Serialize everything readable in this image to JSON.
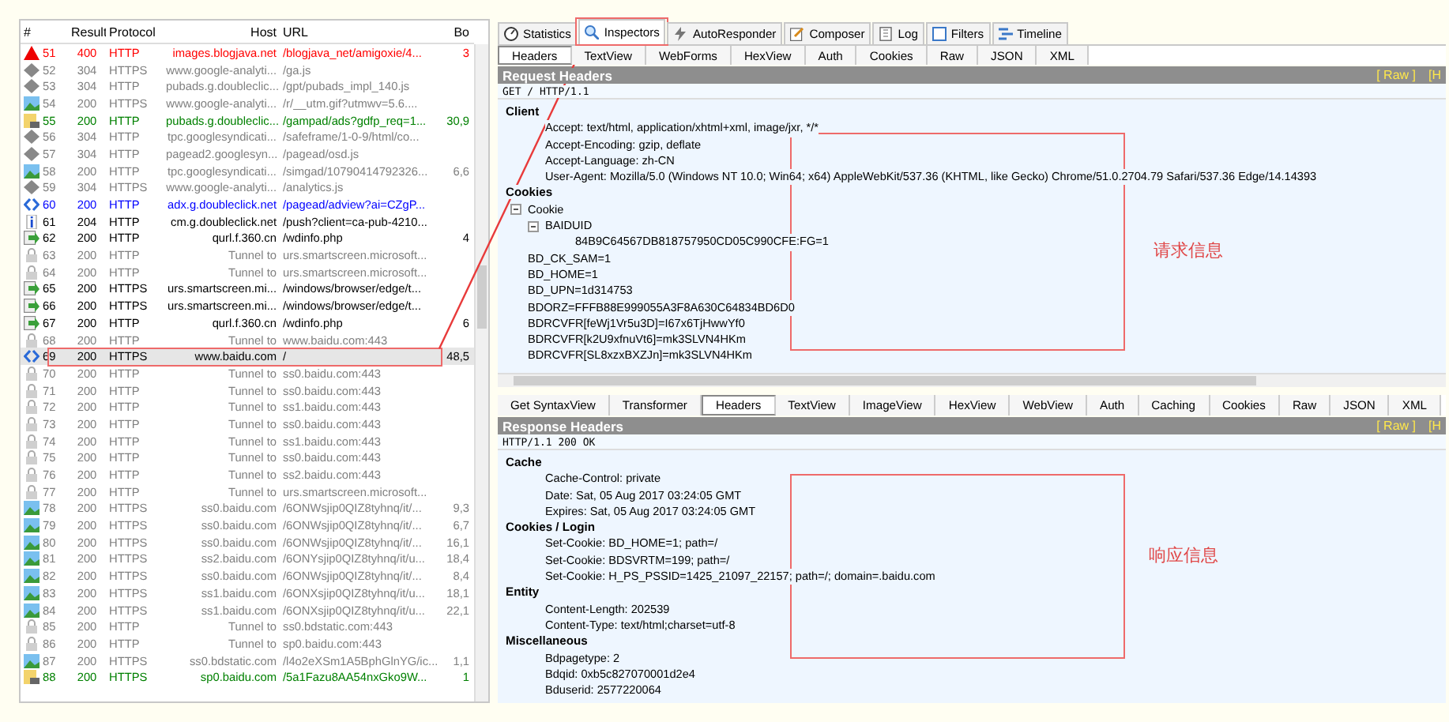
{
  "sessions": {
    "columns": [
      "#",
      "Result",
      "Protocol",
      "Host",
      "URL",
      "Bo"
    ],
    "rows": [
      {
        "num": "51",
        "result": "400",
        "protocol": "HTTP",
        "host": "images.blogjava.net",
        "url": "/blogjava_net/amigoxie/4...",
        "body": "3",
        "kind": "warning",
        "color": "#ff0000",
        "selected": false
      },
      {
        "num": "52",
        "result": "304",
        "protocol": "HTTPS",
        "host": "www.google-analyti...",
        "url": "/ga.js",
        "kind": "cached",
        "color": "#808080",
        "selected": false
      },
      {
        "num": "53",
        "result": "304",
        "protocol": "HTTP",
        "host": "pubads.g.doubleclic...",
        "url": "/gpt/pubads_impl_140.js",
        "kind": "cached",
        "color": "#808080",
        "selected": false
      },
      {
        "num": "54",
        "result": "200",
        "protocol": "HTTPS",
        "host": "www.google-analyti...",
        "url": "/r/__utm.gif?utmwv=5.6....",
        "kind": "image",
        "color": "#808080",
        "selected": false
      },
      {
        "num": "55",
        "result": "200",
        "protocol": "HTTP",
        "host": "pubads.g.doubleclic...",
        "url": "/gampad/ads?gdfp_req=1...",
        "body": "30,9",
        "kind": "script",
        "color": "#008000",
        "selected": false
      },
      {
        "num": "56",
        "result": "304",
        "protocol": "HTTP",
        "host": "tpc.googlesyndicati...",
        "url": "/safeframe/1-0-9/html/co...",
        "kind": "cached",
        "color": "#808080",
        "selected": false
      },
      {
        "num": "57",
        "result": "304",
        "protocol": "HTTP",
        "host": "pagead2.googlesyn...",
        "url": "/pagead/osd.js",
        "kind": "cached",
        "color": "#808080",
        "selected": false
      },
      {
        "num": "58",
        "result": "200",
        "protocol": "HTTP",
        "host": "tpc.googlesyndicati...",
        "url": "/simgad/10790414792326...",
        "body": "6,6",
        "kind": "image",
        "color": "#808080",
        "selected": false
      },
      {
        "num": "59",
        "result": "304",
        "protocol": "HTTPS",
        "host": "www.google-analyti...",
        "url": "/analytics.js",
        "kind": "cached",
        "color": "#808080",
        "selected": false
      },
      {
        "num": "60",
        "result": "200",
        "protocol": "HTTP",
        "host": "adx.g.doubleclick.net",
        "url": "/pagead/adview?ai=CZgP...",
        "kind": "page",
        "color": "#0000ff",
        "selected": false
      },
      {
        "num": "61",
        "result": "204",
        "protocol": "HTTP",
        "host": "cm.g.doubleclick.net",
        "url": "/push?client=ca-pub-4210...",
        "kind": "info",
        "color": "#000000",
        "selected": false
      },
      {
        "num": "62",
        "result": "200",
        "protocol": "HTTP",
        "host": "qurl.f.360.cn",
        "url": "/wdinfo.php",
        "body": "4",
        "kind": "arrow",
        "color": "#000000",
        "selected": false
      },
      {
        "num": "63",
        "result": "200",
        "protocol": "HTTP",
        "host": "Tunnel to",
        "url": "urs.smartscreen.microsoft...",
        "kind": "tunnel",
        "color": "#808080",
        "selected": false
      },
      {
        "num": "64",
        "result": "200",
        "protocol": "HTTP",
        "host": "Tunnel to",
        "url": "urs.smartscreen.microsoft...",
        "kind": "tunnel",
        "color": "#808080",
        "selected": false
      },
      {
        "num": "65",
        "result": "200",
        "protocol": "HTTPS",
        "host": "urs.smartscreen.mi...",
        "url": "/windows/browser/edge/t...",
        "kind": "arrow",
        "color": "#000000",
        "selected": false
      },
      {
        "num": "66",
        "result": "200",
        "protocol": "HTTPS",
        "host": "urs.smartscreen.mi...",
        "url": "/windows/browser/edge/t...",
        "kind": "arrow",
        "color": "#000000",
        "selected": false
      },
      {
        "num": "67",
        "result": "200",
        "protocol": "HTTP",
        "host": "qurl.f.360.cn",
        "url": "/wdinfo.php",
        "body": "6",
        "kind": "arrow",
        "color": "#000000",
        "selected": false
      },
      {
        "num": "68",
        "result": "200",
        "protocol": "HTTP",
        "host": "Tunnel to",
        "url": "www.baidu.com:443",
        "kind": "tunnel",
        "color": "#808080",
        "selected": false
      },
      {
        "num": "69",
        "result": "200",
        "protocol": "HTTPS",
        "host": "www.baidu.com",
        "url": "/",
        "body": "48,5",
        "kind": "page",
        "color": "#000000",
        "selected": true
      },
      {
        "num": "70",
        "result": "200",
        "protocol": "HTTP",
        "host": "Tunnel to",
        "url": "ss0.baidu.com:443",
        "kind": "tunnel",
        "color": "#808080",
        "selected": false
      },
      {
        "num": "71",
        "result": "200",
        "protocol": "HTTP",
        "host": "Tunnel to",
        "url": "ss0.baidu.com:443",
        "kind": "tunnel",
        "color": "#808080",
        "selected": false
      },
      {
        "num": "72",
        "result": "200",
        "protocol": "HTTP",
        "host": "Tunnel to",
        "url": "ss1.baidu.com:443",
        "kind": "tunnel",
        "color": "#808080",
        "selected": false
      },
      {
        "num": "73",
        "result": "200",
        "protocol": "HTTP",
        "host": "Tunnel to",
        "url": "ss0.baidu.com:443",
        "kind": "tunnel",
        "color": "#808080",
        "selected": false
      },
      {
        "num": "74",
        "result": "200",
        "protocol": "HTTP",
        "host": "Tunnel to",
        "url": "ss1.baidu.com:443",
        "kind": "tunnel",
        "color": "#808080",
        "selected": false
      },
      {
        "num": "75",
        "result": "200",
        "protocol": "HTTP",
        "host": "Tunnel to",
        "url": "ss0.baidu.com:443",
        "kind": "tunnel",
        "color": "#808080",
        "selected": false
      },
      {
        "num": "76",
        "result": "200",
        "protocol": "HTTP",
        "host": "Tunnel to",
        "url": "ss2.baidu.com:443",
        "kind": "tunnel",
        "color": "#808080",
        "selected": false
      },
      {
        "num": "77",
        "result": "200",
        "protocol": "HTTP",
        "host": "Tunnel to",
        "url": "urs.smartscreen.microsoft...",
        "kind": "tunnel",
        "color": "#808080",
        "selected": false
      },
      {
        "num": "78",
        "result": "200",
        "protocol": "HTTPS",
        "host": "ss0.baidu.com",
        "url": "/6ONWsjip0QIZ8tyhnq/it/...",
        "body": "9,3",
        "kind": "image",
        "color": "#808080",
        "selected": false
      },
      {
        "num": "79",
        "result": "200",
        "protocol": "HTTPS",
        "host": "ss0.baidu.com",
        "url": "/6ONWsjip0QIZ8tyhnq/it/...",
        "body": "6,7",
        "kind": "image",
        "color": "#808080",
        "selected": false
      },
      {
        "num": "80",
        "result": "200",
        "protocol": "HTTPS",
        "host": "ss0.baidu.com",
        "url": "/6ONWsjip0QIZ8tyhnq/it/...",
        "body": "16,1",
        "kind": "image",
        "color": "#808080",
        "selected": false
      },
      {
        "num": "81",
        "result": "200",
        "protocol": "HTTPS",
        "host": "ss2.baidu.com",
        "url": "/6ONYsjip0QIZ8tyhnq/it/u...",
        "body": "18,4",
        "kind": "image",
        "color": "#808080",
        "selected": false
      },
      {
        "num": "82",
        "result": "200",
        "protocol": "HTTPS",
        "host": "ss0.baidu.com",
        "url": "/6ONWsjip0QIZ8tyhnq/it/...",
        "body": "8,4",
        "kind": "image",
        "color": "#808080",
        "selected": false
      },
      {
        "num": "83",
        "result": "200",
        "protocol": "HTTPS",
        "host": "ss1.baidu.com",
        "url": "/6ONXsjip0QIZ8tyhnq/it/u...",
        "body": "18,1",
        "kind": "image",
        "color": "#808080",
        "selected": false
      },
      {
        "num": "84",
        "result": "200",
        "protocol": "HTTPS",
        "host": "ss1.baidu.com",
        "url": "/6ONXsjip0QIZ8tyhnq/it/u...",
        "body": "22,1",
        "kind": "image",
        "color": "#808080",
        "selected": false
      },
      {
        "num": "85",
        "result": "200",
        "protocol": "HTTP",
        "host": "Tunnel to",
        "url": "ss0.bdstatic.com:443",
        "kind": "tunnel",
        "color": "#808080",
        "selected": false
      },
      {
        "num": "86",
        "result": "200",
        "protocol": "HTTP",
        "host": "Tunnel to",
        "url": "sp0.baidu.com:443",
        "kind": "tunnel",
        "color": "#808080",
        "selected": false
      },
      {
        "num": "87",
        "result": "200",
        "protocol": "HTTPS",
        "host": "ss0.bdstatic.com",
        "url": "/l4o2eXSm1A5BphGlnYG/ic...",
        "body": "1,1",
        "kind": "image",
        "color": "#808080",
        "selected": false
      },
      {
        "num": "88",
        "result": "200",
        "protocol": "HTTPS",
        "host": "sp0.baidu.com",
        "url": "/5a1Fazu8AA54nxGko9W...",
        "body": "1",
        "kind": "script",
        "color": "#008000",
        "selected": false
      }
    ]
  },
  "inspector_tabs": [
    {
      "label": "Statistics",
      "kind": "gauge",
      "selected": false
    },
    {
      "label": "Inspectors",
      "kind": "magnifier",
      "selected": true
    },
    {
      "label": "AutoResponder",
      "kind": "bolt",
      "selected": false
    },
    {
      "label": "Composer",
      "kind": "pencil",
      "selected": false
    },
    {
      "label": "Log",
      "kind": "log",
      "selected": false
    },
    {
      "label": "Filters",
      "kind": "checkbox",
      "selected": false
    },
    {
      "label": "Timeline",
      "kind": "timeline",
      "selected": false
    }
  ],
  "request": {
    "tabs": [
      {
        "label": "Headers",
        "selected": true
      },
      {
        "label": "TextView",
        "selected": false
      },
      {
        "label": "WebForms",
        "selected": false
      },
      {
        "label": "HexView",
        "selected": false
      },
      {
        "label": "Auth",
        "selected": false
      },
      {
        "label": "Cookies",
        "selected": false
      },
      {
        "label": "Raw",
        "selected": false
      },
      {
        "label": "JSON",
        "selected": false
      },
      {
        "label": "XML",
        "selected": false
      }
    ],
    "title": "Request Headers",
    "raw_link": "[ Raw ]",
    "header_link": "[H",
    "status_line": "GET / HTTP/1.1",
    "groups": [
      {
        "name": "Client",
        "items": [
          {
            "label": "Accept: text/html, application/xhtml+xml, image/jxr, */*"
          },
          {
            "label": "Accept-Encoding: gzip, deflate"
          },
          {
            "label": "Accept-Language: zh-CN"
          },
          {
            "label": "User-Agent: Mozilla/5.0 (Windows NT 10.0; Win64; x64) AppleWebKit/537.36 (KHTML, like Gecko) Chrome/51.0.2704.79 Safari/537.36 Edge/14.14393"
          }
        ]
      },
      {
        "name": "Cookies",
        "items": [
          {
            "label": "Cookie",
            "expanded": true,
            "children": [
              {
                "label": "BAIDUID",
                "expanded": true,
                "children": [
                  {
                    "label": "84B9C64567DB818757950CD05C990CFE:FG=1"
                  }
                ]
              },
              {
                "label": "BD_CK_SAM=1"
              },
              {
                "label": "BD_HOME=1"
              },
              {
                "label": "BD_UPN=1d314753"
              },
              {
                "label": "BDORZ=FFFB88E999055A3F8A630C64834BD6D0"
              },
              {
                "label": "BDRCVFR[feWj1Vr5u3D]=I67x6TjHwwYf0"
              },
              {
                "label": "BDRCVFR[k2U9xfnuVt6]=mk3SLVN4HKm"
              },
              {
                "label": "BDRCVFR[SL8xzxBXZJn]=mk3SLVN4HKm"
              }
            ]
          }
        ]
      }
    ]
  },
  "response": {
    "tabs": [
      {
        "label": "Get SyntaxView",
        "selected": false
      },
      {
        "label": "Transformer",
        "selected": false
      },
      {
        "label": "Headers",
        "selected": true
      },
      {
        "label": "TextView",
        "selected": false
      },
      {
        "label": "ImageView",
        "selected": false
      },
      {
        "label": "HexView",
        "selected": false
      },
      {
        "label": "WebView",
        "selected": false
      },
      {
        "label": "Auth",
        "selected": false
      },
      {
        "label": "Caching",
        "selected": false
      },
      {
        "label": "Cookies",
        "selected": false
      },
      {
        "label": "Raw",
        "selected": false
      },
      {
        "label": "JSON",
        "selected": false
      },
      {
        "label": "XML",
        "selected": false
      }
    ],
    "title": "Response Headers",
    "raw_link": "[ Raw ]",
    "header_link": "[H",
    "status_line": "HTTP/1.1 200 OK",
    "groups": [
      {
        "name": "Cache",
        "items": [
          {
            "label": "Cache-Control: private"
          },
          {
            "label": "Date: Sat, 05 Aug 2017 03:24:05 GMT"
          },
          {
            "label": "Expires: Sat, 05 Aug 2017 03:24:05 GMT"
          }
        ]
      },
      {
        "name": "Cookies / Login",
        "items": [
          {
            "label": "Set-Cookie: BD_HOME=1; path=/"
          },
          {
            "label": "Set-Cookie: BDSVRTM=199; path=/"
          },
          {
            "label": "Set-Cookie: H_PS_PSSID=1425_21097_22157; path=/; domain=.baidu.com"
          }
        ]
      },
      {
        "name": "Entity",
        "items": [
          {
            "label": "Content-Length: 202539"
          },
          {
            "label": "Content-Type: text/html;charset=utf-8"
          }
        ]
      },
      {
        "name": "Miscellaneous",
        "items": [
          {
            "label": "Bdpagetype: 2"
          },
          {
            "label": "Bdqid: 0xb5c827070001d2e4"
          },
          {
            "label": "Bduserid: 2577220064"
          }
        ]
      }
    ]
  },
  "annotations": [
    {
      "label": "请求信息"
    },
    {
      "label": "响应信息"
    }
  ]
}
